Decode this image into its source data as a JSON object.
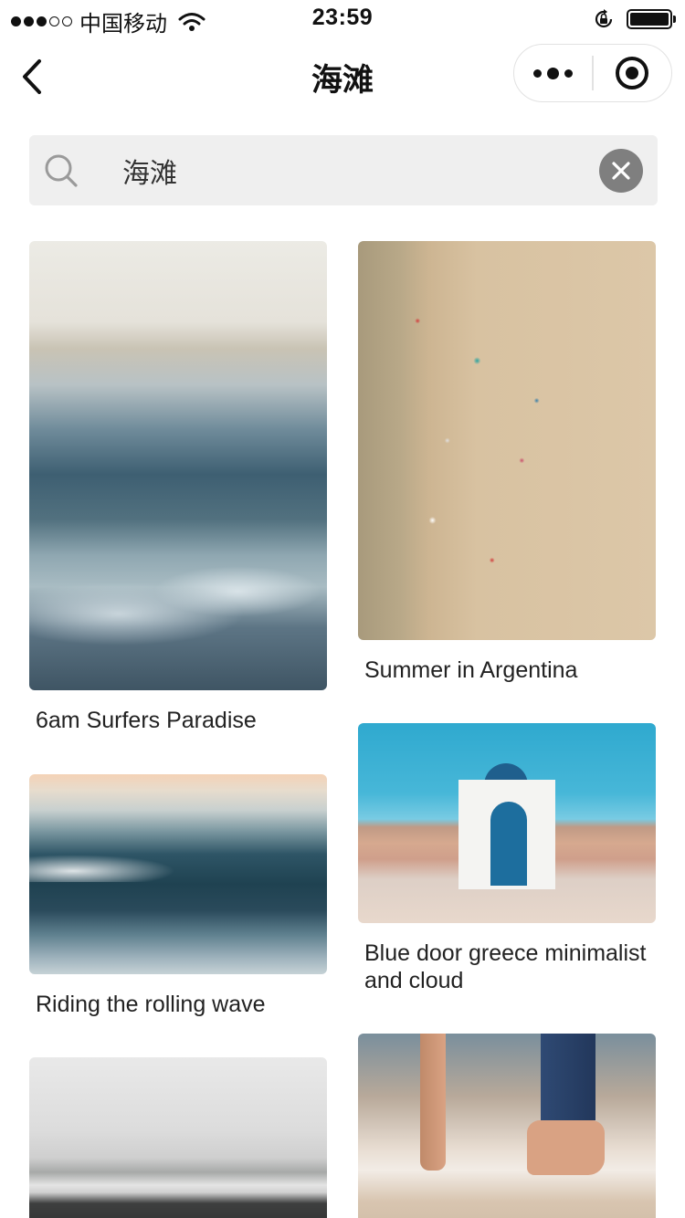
{
  "status_bar": {
    "carrier": "中国移动",
    "time": "23:59",
    "signal_bars_filled": 3,
    "signal_bars_total": 5
  },
  "nav": {
    "title": "海滩"
  },
  "search": {
    "value": "海滩"
  },
  "cards": [
    {
      "caption": "6am Surfers Paradise"
    },
    {
      "caption": "Summer in Argentina"
    },
    {
      "caption": "Blue door greece minimalist and cloud"
    },
    {
      "caption": "Riding the rolling wave"
    },
    {
      "caption": ""
    },
    {
      "caption": ""
    }
  ],
  "colors": {
    "search_background": "#efefef",
    "clear_button": "#7f7f7f",
    "text": "#222222"
  }
}
